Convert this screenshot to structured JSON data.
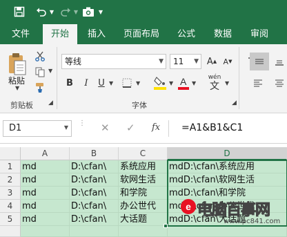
{
  "tabs": [
    "文件",
    "开始",
    "插入",
    "页面布局",
    "公式",
    "数据",
    "审阅"
  ],
  "active_tab": "开始",
  "clipboard": {
    "paste_label": "粘贴",
    "group_label": "剪贴板"
  },
  "font": {
    "name": "等线",
    "size": "11",
    "group_label": "字体",
    "bold": "B",
    "italic": "I",
    "underline": "U",
    "wen": "wén",
    "wen_char": "文"
  },
  "name_box": "D1",
  "formula_icon": "fx",
  "formula": "=A1&B1&C1",
  "columns": [
    "A",
    "B",
    "C",
    "D"
  ],
  "rows": [
    {
      "num": "1",
      "a": "md",
      "b": "D:\\cfan\\",
      "c": "系统应用",
      "d": "mdD:\\cfan\\系统应用"
    },
    {
      "num": "2",
      "a": "md",
      "b": "D:\\cfan\\",
      "c": "软网生活",
      "d": "mdD:\\cfan\\软网生活"
    },
    {
      "num": "3",
      "a": "md",
      "b": "D:\\cfan\\",
      "c": "和学院",
      "d": "mdD:\\cfan\\和学院"
    },
    {
      "num": "4",
      "a": "md",
      "b": "D:\\cfan\\",
      "c": "办公世代",
      "d": "mdD:\\cfan\\办公世代"
    },
    {
      "num": "5",
      "a": "md",
      "b": "D:\\cfan\\",
      "c": "大话题",
      "d": "mdD:\\cfan\\大话题"
    }
  ],
  "watermark": {
    "text": "电脑百事网",
    "url": "www.pc841.com"
  },
  "colors": {
    "excel_green": "#217346",
    "cell_fill": "#c6e7cf",
    "font_color_red": "#e81123",
    "highlight_yellow": "#ffe100"
  }
}
